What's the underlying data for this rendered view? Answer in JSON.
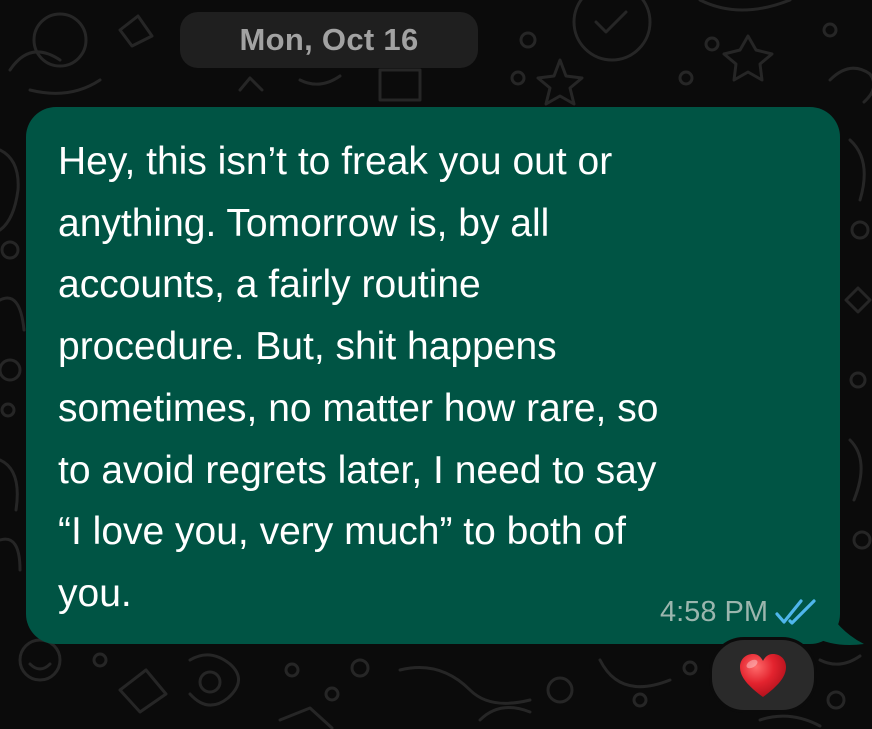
{
  "chat": {
    "date_separator": "Mon, Oct 16"
  },
  "message": {
    "text": "Hey, this isn’t to freak you out or\nanything. Tomorrow is, by all\naccounts, a fairly routine\nprocedure. But, shit happens\nsometimes, no matter how rare, so\nto avoid regrets later, I need to say\n“I love you, very much” to both of\nyou.",
    "time": "4:58 PM",
    "status_icon": "double-check-read-icon",
    "reaction_icon": "red-heart-icon"
  },
  "colors": {
    "background": "#0b0b0b",
    "outgoing_bubble": "#005444",
    "date_pill": "#1f1f1f",
    "date_text": "#a2a2a2",
    "message_text": "#ffffff",
    "time_text": "#9bb6ae",
    "read_ticks": "#4fb6ec",
    "reaction_pill": "#2a2a2a",
    "heart": "#e3232e"
  }
}
